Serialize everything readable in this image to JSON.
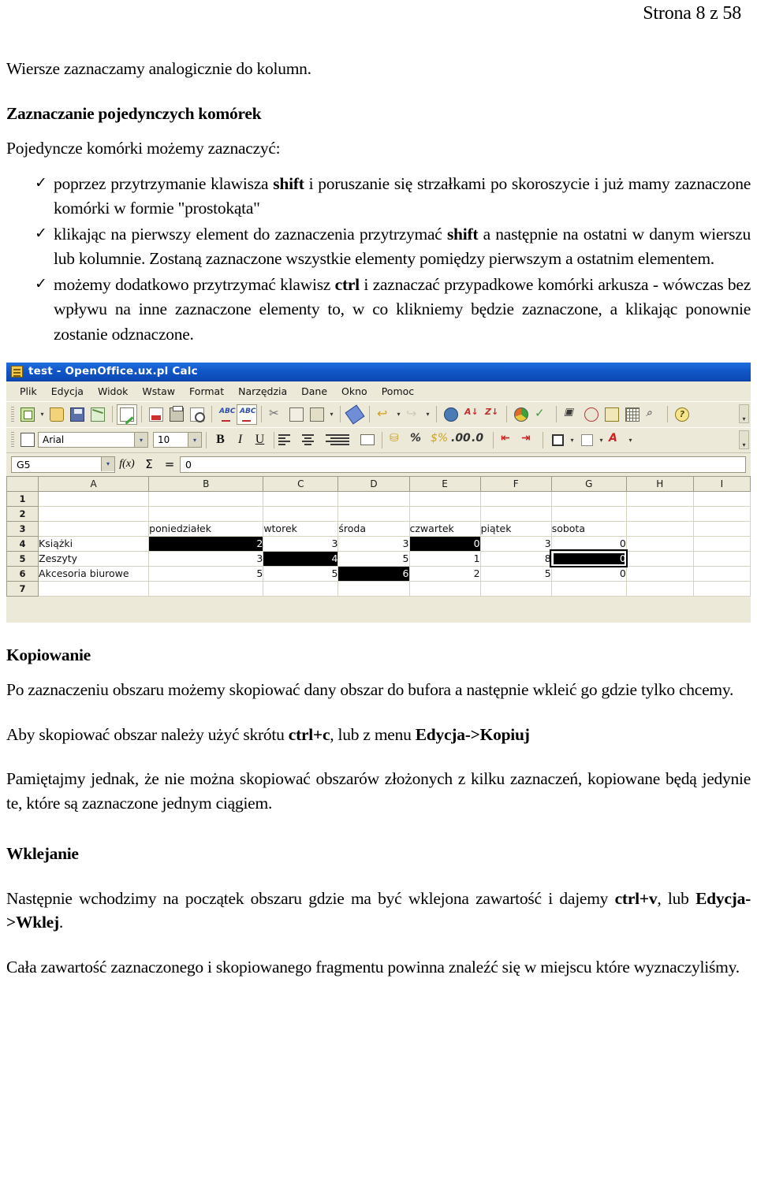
{
  "header": {
    "page_label": "Strona 8 z 58"
  },
  "body": {
    "intro_line": "Wiersze zaznaczamy analogicznie do kolumn.",
    "heading_single_cells": "Zaznaczanie pojedynczych komórek",
    "lead_single_cells": "Pojedyncze komórki możemy zaznaczyć:",
    "bullets": [
      {
        "tick": "✓",
        "pre": "poprzez przytrzymanie klawisza ",
        "bold": "shift",
        "post": " i poruszanie się strzałkami po skoroszycie i już mamy zaznaczone komórki w formie \"prostokąta\""
      },
      {
        "tick": "✓",
        "pre": "klikając na pierwszy element do zaznaczenia przytrzymać ",
        "bold": "shift",
        "post": " a następnie na ostatni w danym wierszu lub kolumnie. Zostaną zaznaczone wszystkie elementy pomiędzy pierwszym a ostatnim elementem."
      },
      {
        "tick": "✓",
        "pre": "możemy dodatkowo przytrzymać klawisz ",
        "bold": "ctrl",
        "post": " i zaznaczać przypadkowe komórki arkusza - wówczas bez wpływu na inne zaznaczone elementy to, w co klikniemy będzie zaznaczone, a klikając ponownie zostanie odznaczone."
      }
    ],
    "heading_copy": "Kopiowanie",
    "copy_para_1": "Po zaznaczeniu obszaru możemy skopiować dany obszar do bufora a następnie wkleić go gdzie tylko chcemy.",
    "copy_para_2_pre": "Aby skopiować obszar należy użyć skrótu ",
    "copy_para_2_bold1": "ctrl+c",
    "copy_para_2_mid": ", lub z menu ",
    "copy_para_2_bold2": "Edycja->Kopiuj",
    "copy_para_3": "Pamiętajmy jednak, że nie można skopiować obszarów złożonych z kilku zaznaczeń, kopiowane będą jedynie te, które są zaznaczone jednym ciągiem.",
    "heading_paste": "Wklejanie",
    "paste_para_1_pre": "Następnie wchodzimy na początek obszaru gdzie ma być wklejona zawartość i dajemy ",
    "paste_para_1_bold1": "ctrl+v",
    "paste_para_1_mid": ", lub ",
    "paste_para_1_bold2": "Edycja->Wklej",
    "paste_para_1_end": ".",
    "paste_para_2": "Cała zawartość zaznaczonego i skopiowanego fragmentu powinna znaleźć się w miejscu które wyznaczyliśmy."
  },
  "calc": {
    "title": "test - OpenOffice.ux.pl Calc",
    "app_icon": "calc-document-icon",
    "menu": [
      "Plik",
      "Edycja",
      "Widok",
      "Wstaw",
      "Format",
      "Narzędzia",
      "Dane",
      "Okno",
      "Pomoc"
    ],
    "toolbar_standard": [
      "new-icon",
      "new-dropdown-icon",
      "open-icon",
      "save-icon",
      "email-icon",
      "edit-file-icon",
      "export-pdf-icon",
      "print-icon",
      "print-preview-icon",
      "spellcheck-icon",
      "autospellcheck-icon",
      "cut-icon",
      "copy-icon",
      "paste-icon",
      "paste-dropdown-icon",
      "clone-formatting-icon",
      "undo-icon",
      "undo-dropdown-icon",
      "redo-icon",
      "redo-dropdown-icon",
      "hyperlink-icon",
      "sort-ascending-icon",
      "sort-descending-icon",
      "insert-chart-icon",
      "show-draw-functions-icon",
      "find-replace-icon",
      "navigator-icon",
      "gallery-icon",
      "data-sources-icon",
      "zoom-icon",
      "help-icon",
      "toolbar-overflow-icon"
    ],
    "toolbar_formatting": [
      "styles-icon",
      "font-name-box",
      "font-size-box",
      "bold-icon",
      "italic-icon",
      "underline-icon",
      "align-left-icon",
      "align-center-icon",
      "align-right-icon",
      "align-justified-icon",
      "merge-cells-icon",
      "currency-format-icon",
      "percent-format-icon",
      "standard-format-icon",
      "add-decimal-icon",
      "delete-decimal-icon",
      "decrease-indent-icon",
      "increase-indent-icon",
      "borders-icon",
      "borders-dropdown-icon",
      "background-color-icon",
      "background-dropdown-icon",
      "font-color-icon",
      "font-color-dropdown-icon",
      "toolbar-overflow-icon"
    ],
    "font_name": "Arial",
    "font_size": "10",
    "name_box_value": "G5",
    "formula_value": "0",
    "columns": [
      "A",
      "B",
      "C",
      "D",
      "E",
      "F",
      "G",
      "H",
      "I"
    ],
    "rows": [
      "1",
      "2",
      "3",
      "4",
      "5",
      "6",
      "7"
    ],
    "active_cell": "G5",
    "selected_cells": [
      "B4",
      "E4",
      "C5",
      "G5",
      "D6"
    ],
    "sheet_rows": [
      {
        "row": "1",
        "cells": [
          "",
          "",
          "",
          "",
          "",
          "",
          "",
          "",
          ""
        ]
      },
      {
        "row": "2",
        "cells": [
          "",
          "",
          "",
          "",
          "",
          "",
          "",
          "",
          ""
        ]
      },
      {
        "row": "3",
        "cells": [
          "",
          "poniedziałek",
          "wtorek",
          "środa",
          "czwartek",
          "piątek",
          "sobota",
          "",
          ""
        ]
      },
      {
        "row": "4",
        "cells": [
          "Książki",
          "2",
          "3",
          "3",
          "0",
          "3",
          "0",
          "",
          ""
        ]
      },
      {
        "row": "5",
        "cells": [
          "Zeszyty",
          "3",
          "4",
          "5",
          "1",
          "8",
          "0",
          "",
          ""
        ]
      },
      {
        "row": "6",
        "cells": [
          "Akcesoria biurowe",
          "5",
          "5",
          "6",
          "2",
          "5",
          "0",
          "",
          ""
        ]
      },
      {
        "row": "7",
        "cells": [
          "",
          "",
          "",
          "",
          "",
          "",
          "",
          "",
          ""
        ]
      }
    ]
  }
}
